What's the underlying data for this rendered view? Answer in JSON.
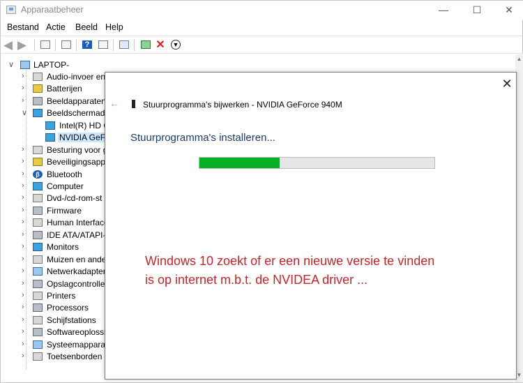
{
  "window": {
    "title": "Apparaatbeheer"
  },
  "menu": [
    "Bestand",
    "Actie",
    "Beeld",
    "Help"
  ],
  "toolbar": {
    "icons": [
      "back-arrow-icon",
      "forward-arrow-icon",
      "show-hide-tree-icon",
      "properties-icon",
      "help-icon",
      "view-icon",
      "scan-hardware-icon",
      "update-driver-icon",
      "uninstall-icon",
      "disable-icon"
    ]
  },
  "tree": {
    "root": "LAPTOP-",
    "items": [
      {
        "label": "Audio-invoer en",
        "expanded": false
      },
      {
        "label": "Batterijen",
        "expanded": false
      },
      {
        "label": "Beeldapparaten",
        "expanded": false
      },
      {
        "label": "Beeldschermada",
        "expanded": true
      },
      {
        "label": "Intel(R) HD G",
        "child": true
      },
      {
        "label": "NVIDIA GeFo",
        "child": true,
        "selected": true
      },
      {
        "label": "Besturing voor g",
        "expanded": false
      },
      {
        "label": "Beveiligingsappa",
        "expanded": false
      },
      {
        "label": "Bluetooth",
        "expanded": false
      },
      {
        "label": "Computer",
        "expanded": false
      },
      {
        "label": "Dvd-/cd-rom-st",
        "expanded": false
      },
      {
        "label": "Firmware",
        "expanded": false
      },
      {
        "label": "Human Interface",
        "expanded": false
      },
      {
        "label": "IDE ATA/ATAPI-c",
        "expanded": false
      },
      {
        "label": "Monitors",
        "expanded": false
      },
      {
        "label": "Muizen en ande",
        "expanded": false
      },
      {
        "label": "Netwerkadapter",
        "expanded": false
      },
      {
        "label": "Opslagcontrolle",
        "expanded": false
      },
      {
        "label": "Printers",
        "expanded": false
      },
      {
        "label": "Processors",
        "expanded": false
      },
      {
        "label": "Schijfstations",
        "expanded": false
      },
      {
        "label": "Softwareoplossi",
        "expanded": false
      },
      {
        "label": "Systeemapparat",
        "expanded": false
      },
      {
        "label": "Toetsenborden",
        "expanded": false
      }
    ]
  },
  "dialog": {
    "header": "Stuurprogramma's bijwerken - NVIDIA GeForce 940M",
    "status": "Stuurprogramma's installeren...",
    "progress": 0.34,
    "progress_color": "#06b025",
    "annotation_line1": "Windows 10 zoekt of er een nieuwe versie te vinden",
    "annotation_line2": "is op internet m.b.t. de NVIDEA driver ...",
    "annotation_color": "#c0272d"
  }
}
